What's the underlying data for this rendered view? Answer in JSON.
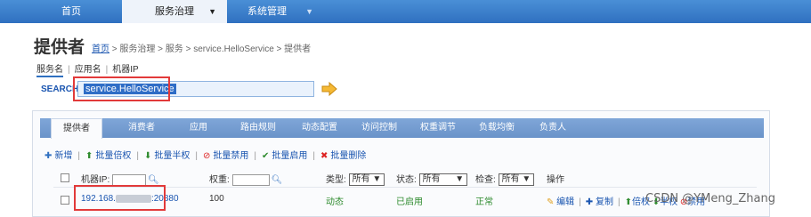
{
  "nav": {
    "home": "首页",
    "service_governance": "服务治理",
    "system_management": "系统管理",
    "caret": "▼"
  },
  "page": {
    "title": "提供者",
    "breadcrumb": {
      "home": "首页",
      "rest": " > 服务治理 > 服务 > service.HelloService > 提供者"
    },
    "subtabs": [
      "服务名",
      "应用名",
      "机器IP"
    ]
  },
  "search": {
    "label": "SEARCH",
    "value": "service.HelloService"
  },
  "tabs": [
    "提供者",
    "消费者",
    "应用",
    "路由规则",
    "动态配置",
    "访问控制",
    "权重调节",
    "负载均衡",
    "负责人"
  ],
  "toolbar": {
    "add": "新增",
    "batch_double": "批量倍权",
    "batch_half": "批量半权",
    "batch_disable": "批量禁用",
    "batch_enable": "批量启用",
    "batch_delete": "批量删除"
  },
  "table_header": {
    "ip": "机器IP:",
    "weight": "权重:",
    "type": "类型:",
    "type_sel": "所有",
    "status": "状态:",
    "status_sel": "所有",
    "check": "检查:",
    "check_sel": "所有",
    "ops": "操作"
  },
  "row": {
    "ip_prefix": "192.168.",
    "ip_suffix": ":20880",
    "weight": "100",
    "type": "动态",
    "status": "已启用",
    "check": "正常",
    "edit": "编辑",
    "copy": "复制",
    "double": "倍权",
    "half": "半权",
    "disable": "禁用"
  },
  "watermark": "CSDN @YMeng_Zhang",
  "colors": {
    "nav_blue": "#2f70c0",
    "highlight_red": "#e23a3a",
    "link_blue": "#1a55b0",
    "ok_green": "#2e8b2e"
  }
}
